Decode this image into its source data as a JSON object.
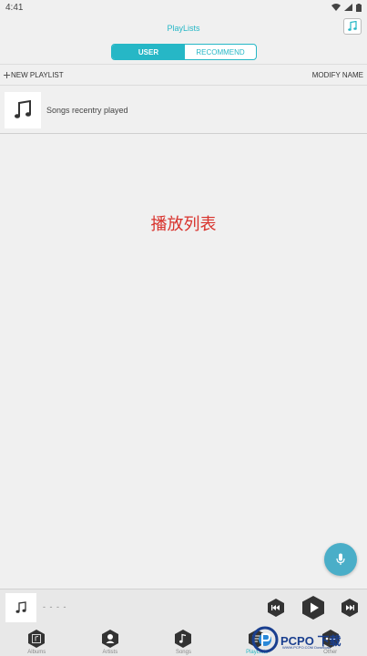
{
  "status": {
    "time": "4:41"
  },
  "header": {
    "title": "PlayLists"
  },
  "tabs": [
    {
      "label": "USER",
      "active": true
    },
    {
      "label": "RECOMMEND",
      "active": false
    }
  ],
  "toolbar": {
    "new_playlist": "NEW PLAYLIST",
    "modify_name": "MODIFY NAME"
  },
  "playlists": [
    {
      "label": "Songs recentry played"
    }
  ],
  "center_label": "播放列表",
  "player": {
    "track": "- - - -"
  },
  "nav": [
    {
      "label": "Albums",
      "icon": "album-icon"
    },
    {
      "label": "Artists",
      "icon": "artist-icon"
    },
    {
      "label": "Songs",
      "icon": "song-icon"
    },
    {
      "label": "PlayLists",
      "icon": "playlist-icon",
      "active": true
    },
    {
      "label": "Other",
      "icon": "other-icon"
    }
  ],
  "watermark": {
    "text": "PCPO 下载",
    "sub": "WWW.PCPO.COM Download"
  },
  "colors": {
    "accent": "#26b7c6",
    "center_label": "#d8322c",
    "fab": "#4aaec8"
  }
}
